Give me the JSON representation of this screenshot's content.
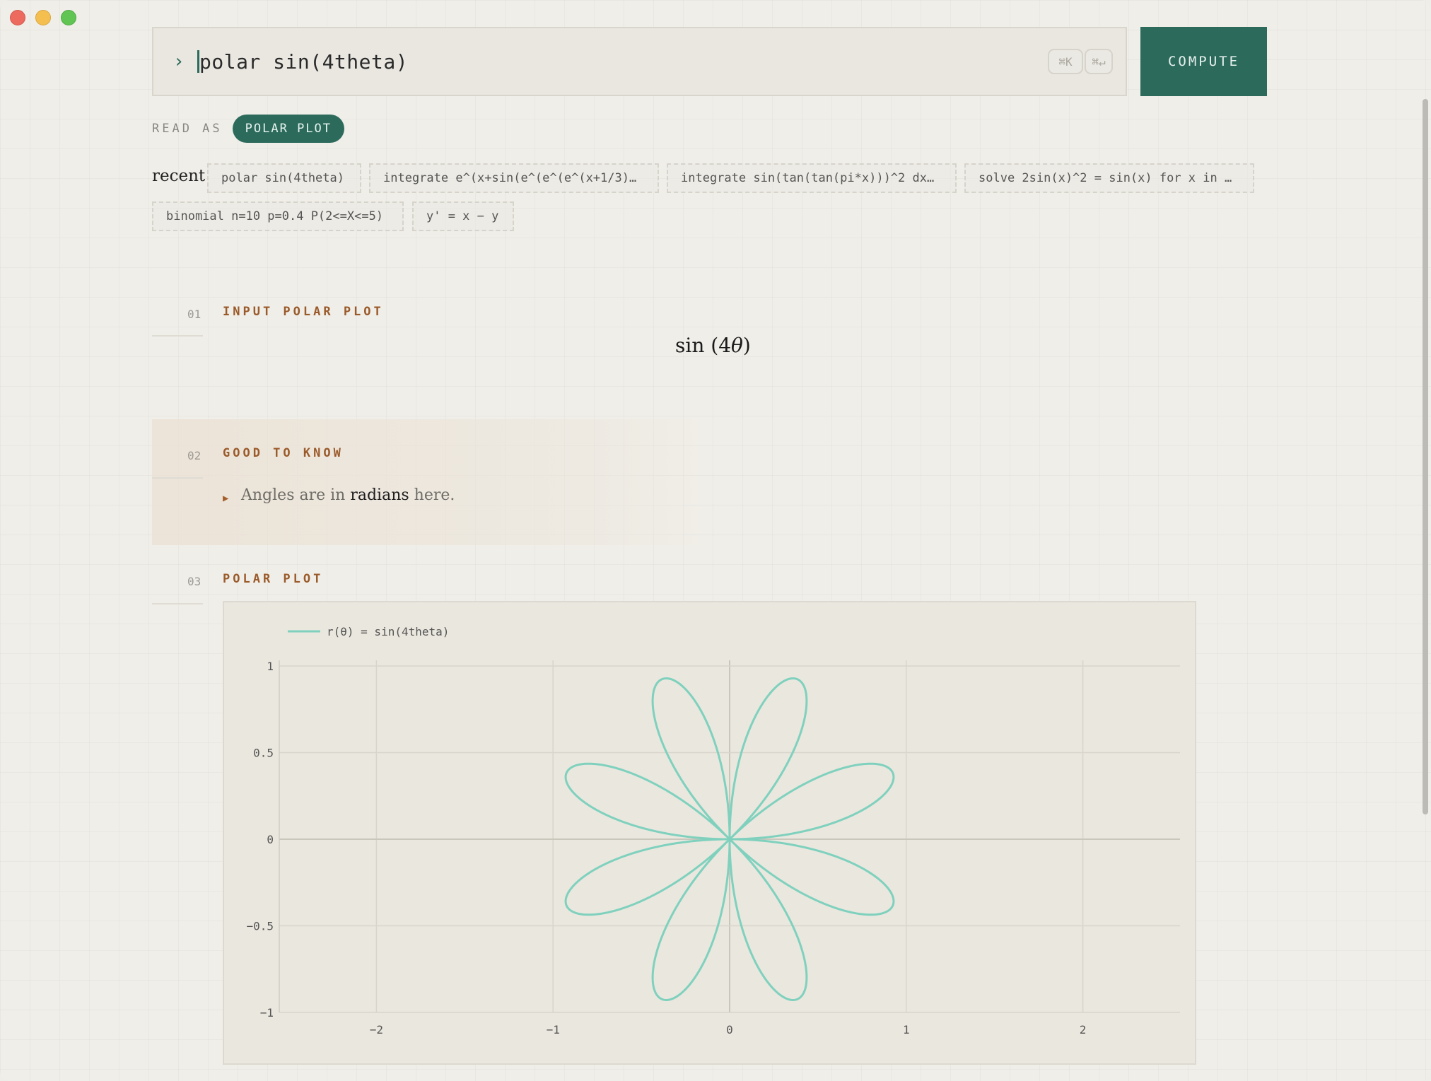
{
  "window": {
    "traffic_lights": [
      "close",
      "minimize",
      "zoom"
    ]
  },
  "query": {
    "prompt_icon": "chevron-right-icon",
    "value": "polar sin(4theta)",
    "shortcut_1": "⌘K",
    "shortcut_2": "⌘↵"
  },
  "compute": {
    "label": "COMPUTE"
  },
  "read_as": {
    "label": "READ AS",
    "value": "POLAR PLOT"
  },
  "recent": {
    "label": "recent",
    "items": [
      "polar sin(4theta)",
      "integrate e^(x+sin(e^(e^(e^(x+1/3)…",
      "integrate sin(tan(tan(pi*x)))^2 dx…",
      "solve 2sin(x)^2 = sin(x) for x in …",
      "binomial n=10 p=0.4 P(2<=X<=5)",
      "y' = x − y"
    ]
  },
  "sections": [
    {
      "num": "01",
      "title": "INPUT POLAR PLOT"
    },
    {
      "num": "02",
      "title": "GOOD TO KNOW"
    },
    {
      "num": "03",
      "title": "POLAR PLOT"
    }
  ],
  "input_math": {
    "func": "sin",
    "open": "(",
    "coef": "4",
    "var": "θ",
    "close": ")"
  },
  "note": {
    "before": "Angles are in ",
    "bold": "radians",
    "after": " here."
  },
  "colors": {
    "accent": "#2c6b5c",
    "section_title": "#9a5a2a",
    "curve": "#7fd1be"
  },
  "chart_data": {
    "type": "line",
    "subtype": "polar",
    "series": [
      {
        "name": "r(θ) = sin(4theta)",
        "equation": "r = sin(4θ)",
        "theta_range": [
          0,
          6.283185
        ]
      }
    ],
    "xlim": [
      -2.55,
      2.55
    ],
    "ylim": [
      -1,
      1
    ],
    "x_ticks": [
      -2,
      -1,
      0,
      1,
      2
    ],
    "x_tick_labels": [
      "−2",
      "−1",
      "0",
      "1",
      "2"
    ],
    "y_ticks": [
      1,
      0.5,
      0,
      -0.5,
      -1
    ],
    "y_tick_labels": [
      "1",
      "0.5",
      "0",
      "−0.5",
      "−1"
    ],
    "grid": true,
    "legend": "top-left"
  }
}
